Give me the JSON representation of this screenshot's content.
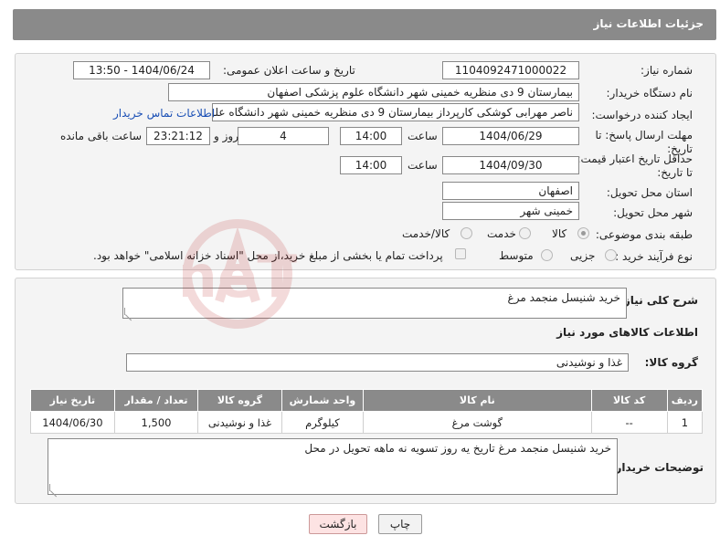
{
  "header": {
    "title": "جزئیات اطلاعات نیاز"
  },
  "form": {
    "need_number_label": "شماره نیاز:",
    "need_number": "1104092471000022",
    "announce_label": "تاریخ و ساعت اعلان عمومی:",
    "announce_value": "1404/06/24 - 13:50",
    "buyer_org_label": "نام دستگاه خریدار:",
    "buyer_org": "بیمارستان 9 دی منظریه خمینی شهر دانشگاه علوم پزشکی اصفهان",
    "creator_label": "ایجاد کننده درخواست:",
    "creator": "ناصر مهرابی کوشکی کارپرداز بیمارستان 9 دی منظریه خمینی شهر دانشگاه علو",
    "contact_link": "اطلاعات تماس خریدار",
    "deadline_label": "مهلت ارسال پاسخ: تا تاریخ:",
    "deadline_date": "1404/06/29",
    "time_label": "ساعت",
    "deadline_time": "14:00",
    "days_value": "4",
    "days_label": "روز و",
    "remaining_value": "23:21:12",
    "remaining_label": "ساعت باقی مانده",
    "price_valid_label": "حداقل تاریخ اعتبار قیمت: تا تاریخ:",
    "price_valid_date": "1404/09/30",
    "price_valid_time": "14:00",
    "province_label": "استان محل تحویل:",
    "province": "اصفهان",
    "city_label": "شهر محل تحویل:",
    "city": "خمینی شهر",
    "category_label": "طبقه بندی موضوعی:",
    "category_options": [
      "کالا",
      "خدمت",
      "کالا/خدمت"
    ],
    "process_label": "نوع فرآیند خرید :",
    "process_options": [
      "جزیی",
      "متوسط"
    ],
    "payment_note": "پرداخت تمام یا بخشی از مبلغ خرید،از محل \"اسناد خزانه اسلامی\" خواهد بود."
  },
  "description": {
    "label": "شرح کلی نیاز:",
    "value": "خرید شنیسل منجمد مرغ"
  },
  "goods": {
    "section_title": "اطلاعات کالاهای مورد نیاز",
    "group_label": "گروه کالا:",
    "group_value": "غذا و نوشیدنی",
    "columns": [
      "ردیف",
      "کد کالا",
      "نام کالا",
      "واحد شمارش",
      "گروه کالا",
      "تعداد / مقدار",
      "تاریخ نیاز"
    ],
    "rows": [
      [
        "1",
        "--",
        "گوشت مرغ",
        "کیلوگرم",
        "غذا و نوشیدنی",
        "1,500",
        "1404/06/30"
      ]
    ]
  },
  "buyer_notes": {
    "label": "توضیحات خریدار:",
    "value": "خرید شنیسل منجمد مرغ تاریخ یه روز تسویه نه ماهه تحویل در محل"
  },
  "actions": {
    "print": "چاپ",
    "back": "بازگشت"
  },
  "watermark": {
    "text": "AriaTender.neT"
  },
  "colors": {
    "header": "#8a8a8a",
    "panel": "#f4f4f4",
    "link": "#1a4fb5",
    "back_button": "#fde3e3"
  }
}
